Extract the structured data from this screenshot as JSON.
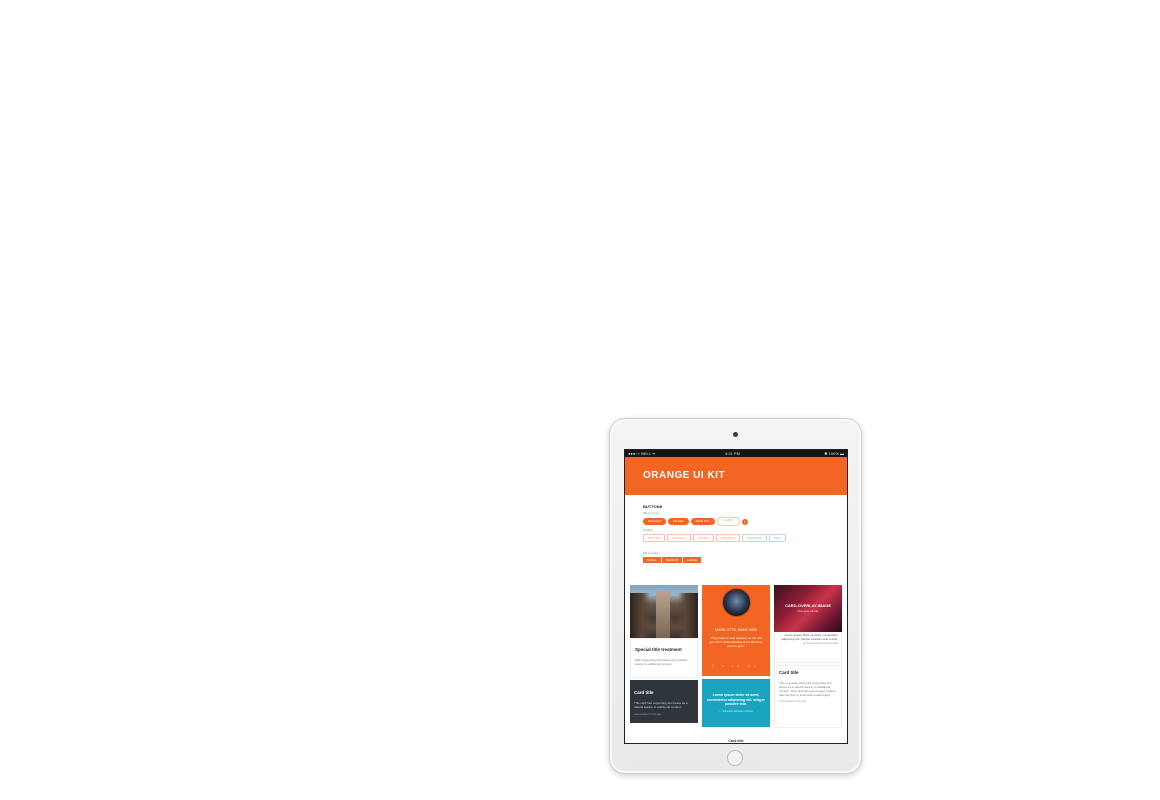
{
  "statusbar": {
    "left": "●●●○○ BELL ᯤ",
    "center": "4:21 PM",
    "right": "✱ 100% ▬"
  },
  "hero": {
    "title": "ORANGE UI KIT"
  },
  "buttons_section": {
    "title": "BUTTONS",
    "pill_label": "Pill you love",
    "pills": [
      "DEFAULT",
      "PILLED",
      "ICON PILL",
      "GHOST"
    ],
    "round_icon": "×",
    "outline_label": "Outline",
    "outlines": [
      "BUTTON",
      "DEFAULT",
      "ACTION",
      "WARNING",
      "SUCCESS",
      "INFO"
    ],
    "square_label": "Pill you like",
    "squares": [
      "SMALL",
      "MEDIUM",
      "LARGE"
    ]
  },
  "cards": {
    "image_card": {
      "title": "Special title treatment",
      "text": "With supporting text below as a natural lead-in to additional content."
    },
    "dark_card": {
      "title": "Card title",
      "text": "This card has supporting text below as a natural lead-in to additional content.",
      "foot": "Last updated 3 mins ago"
    },
    "orange_card": {
      "name": "MARK OTTO, MAKE WEB",
      "quote": "“They need to stop sleeping on me and get some understanding about this here game's gots”",
      "social": "𝕥 f in G+"
    },
    "teal_card": {
      "quote": "Lorem ipsum dolor sit amet, consectetur adipiscing elit. Integer posuere erat.",
      "foot": "— Someone famous in source"
    },
    "col2_tail_title": "Card title",
    "overlay_card": {
      "title": "CARD-OVERLAY-IMAGE",
      "sub": "Here goes sub-title"
    },
    "quote_card": {
      "text": "Lorem ipsum dolor sit amet, consectetur adipiscing elit. Integer posuere erat a ante.",
      "foot": "— Someone famous in source title"
    },
    "white_card": {
      "title": "Card title",
      "text": "This is a wider card with supporting text below as a natural lead-in to additional content. This card has even longer content than the first to show that equal height.",
      "foot": "Last updated 3 mins ago"
    }
  },
  "colors": {
    "accent": "#f26522",
    "teal": "#1aa4bf",
    "dark": "#2e363c"
  }
}
